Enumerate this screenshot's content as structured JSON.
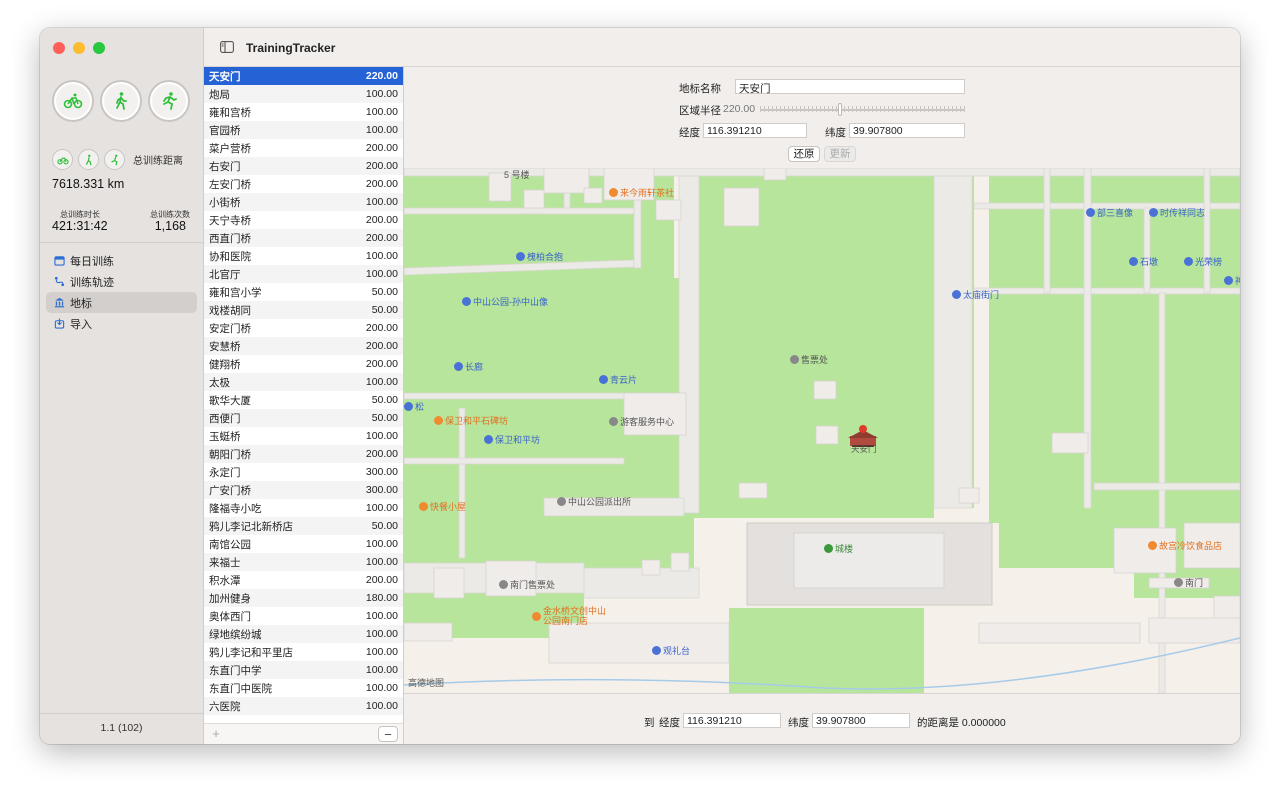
{
  "app": {
    "title": "TrainingTracker",
    "version": "1.1 (102)"
  },
  "sidebar": {
    "big_rings": [
      {
        "icon": "cycling-icon"
      },
      {
        "icon": "walking-icon"
      },
      {
        "icon": "running-icon"
      }
    ],
    "total_distance_label": "总训练距离",
    "total_distance": "7618.331 km",
    "duration_label": "总训练时长",
    "duration": "421:31:42",
    "count_label": "总训练次数",
    "count": "1,168",
    "nav": [
      {
        "label": "每日训练",
        "icon": "calendar-icon"
      },
      {
        "label": "训练轨迹",
        "icon": "route-icon"
      },
      {
        "label": "地标",
        "icon": "landmark-icon",
        "active": true
      },
      {
        "label": "导入",
        "icon": "import-icon"
      }
    ]
  },
  "landmarks": [
    {
      "name": "天安门",
      "value": "220.00"
    },
    {
      "name": "炮局",
      "value": "100.00"
    },
    {
      "name": "雍和宫桥",
      "value": "100.00"
    },
    {
      "name": "官园桥",
      "value": "100.00"
    },
    {
      "name": "菜户营桥",
      "value": "200.00"
    },
    {
      "name": "右安门",
      "value": "200.00"
    },
    {
      "name": "左安门桥",
      "value": "200.00"
    },
    {
      "name": "小街桥",
      "value": "100.00"
    },
    {
      "name": "天宁寺桥",
      "value": "200.00"
    },
    {
      "name": "西直门桥",
      "value": "200.00"
    },
    {
      "name": "协和医院",
      "value": "100.00"
    },
    {
      "name": "北官厅",
      "value": "100.00"
    },
    {
      "name": "雍和宫小学",
      "value": "50.00"
    },
    {
      "name": "戏楼胡同",
      "value": "50.00"
    },
    {
      "name": "安定门桥",
      "value": "200.00"
    },
    {
      "name": "安慧桥",
      "value": "200.00"
    },
    {
      "name": "健翔桥",
      "value": "200.00"
    },
    {
      "name": "太极",
      "value": "100.00"
    },
    {
      "name": "歌华大厦",
      "value": "50.00"
    },
    {
      "name": "西便门",
      "value": "50.00"
    },
    {
      "name": "玉蜓桥",
      "value": "100.00"
    },
    {
      "name": "朝阳门桥",
      "value": "200.00"
    },
    {
      "name": "永定门",
      "value": "300.00"
    },
    {
      "name": "广安门桥",
      "value": "300.00"
    },
    {
      "name": "隆福寺小吃",
      "value": "100.00"
    },
    {
      "name": "鸦儿李记北新桥店",
      "value": "50.00"
    },
    {
      "name": "南馆公园",
      "value": "100.00"
    },
    {
      "name": "来福士",
      "value": "100.00"
    },
    {
      "name": "积水潭",
      "value": "200.00"
    },
    {
      "name": "加州健身",
      "value": "180.00"
    },
    {
      "name": "奥体西门",
      "value": "100.00"
    },
    {
      "name": "绿地缤纷城",
      "value": "100.00"
    },
    {
      "name": "鸦儿李记和平里店",
      "value": "100.00"
    },
    {
      "name": "东直门中学",
      "value": "100.00"
    },
    {
      "name": "东直门中医院",
      "value": "100.00"
    },
    {
      "name": "六医院",
      "value": "100.00"
    }
  ],
  "list_footer": {
    "add": "+",
    "remove": "−"
  },
  "detail": {
    "name_label": "地标名称",
    "name_value": "天安门",
    "radius_label": "区域半径",
    "radius_value": "220.00",
    "radius_fraction": 0.38,
    "lon_label": "经度",
    "lon_value": "116.391210",
    "lat_label": "纬度",
    "lat_value": "39.907800",
    "restore_label": "还原",
    "update_label": "更新"
  },
  "map": {
    "copyright": "高德地图",
    "pois": [
      {
        "name": "5 号楼",
        "kind": "plain"
      },
      {
        "name": "来今雨轩茶社",
        "kind": "orange"
      },
      {
        "name": "槐柏合抱",
        "kind": "blue"
      },
      {
        "name": "中山公园-孙中山像",
        "kind": "blue"
      },
      {
        "name": "长廊",
        "kind": "blue"
      },
      {
        "name": "青云片",
        "kind": "blue"
      },
      {
        "name": "售票处",
        "kind": "gray"
      },
      {
        "name": "游客服务中心",
        "kind": "gray"
      },
      {
        "name": "保卫和平石碑坊",
        "kind": "orange"
      },
      {
        "name": "保卫和平坊",
        "kind": "blue"
      },
      {
        "name": "天安门",
        "kind": "marker"
      },
      {
        "name": "中山公园派出所",
        "kind": "gray"
      },
      {
        "name": "快餐小屋",
        "kind": "orange"
      },
      {
        "name": "城楼",
        "kind": "green"
      },
      {
        "name": "南门售票处",
        "kind": "gray"
      },
      {
        "name": "金水桥文创中山公园南门店",
        "kind": "orange"
      },
      {
        "name": "观礼台",
        "kind": "blue"
      },
      {
        "name": "部三喜像",
        "kind": "blue"
      },
      {
        "name": "时传祥同志",
        "kind": "blue"
      },
      {
        "name": "石墩",
        "kind": "blue"
      },
      {
        "name": "光荣榜",
        "kind": "blue"
      },
      {
        "name": "神",
        "kind": "blue"
      },
      {
        "name": "太庙街门",
        "kind": "blue"
      },
      {
        "name": "故宫冷饮食品店",
        "kind": "orange"
      },
      {
        "name": "南门",
        "kind": "gray"
      },
      {
        "name": "松",
        "kind": "blue"
      }
    ]
  },
  "bottombar": {
    "to_label": "到",
    "lon_label": "经度",
    "lon_value": "116.391210",
    "lat_label": "纬度",
    "lat_value": "39.907800",
    "distance_text": "的距离是 0.000000"
  },
  "colors": {
    "accent": "#2462d6",
    "ring_icon": "#2fbf3a",
    "map_green": "#b6e59b",
    "map_bg": "#f5f1ea"
  }
}
